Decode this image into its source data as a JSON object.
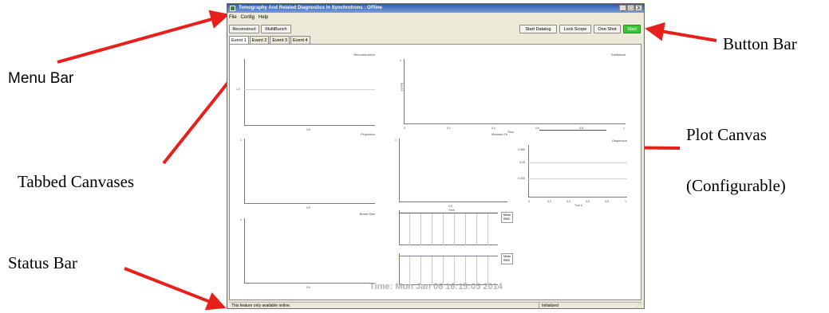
{
  "annotations": {
    "menu_bar": "Menu Bar",
    "tabbed_canvases": "Tabbed Canvases",
    "status_bar": "Status Bar",
    "button_bar": "Button Bar",
    "plot_canvas": "Plot Canvas",
    "plot_canvas_sub": "(Configurable)"
  },
  "colors": {
    "arrow": "#e8201c",
    "start_button": "#3ac43a",
    "titlebar": "#2a56b8"
  },
  "window": {
    "title": "Tomography And Related Diagnostics In Synchrotrons : Offline",
    "controls": [
      "_",
      "□",
      "X"
    ]
  },
  "menu": [
    "File",
    "Config",
    "Help"
  ],
  "toolbar": {
    "left": [
      "Reconstruct",
      "MultiBunch"
    ],
    "right": [
      "Start Datalog",
      "Lock Scope",
      "One Shot",
      "Start"
    ]
  },
  "tabs": [
    "Event 1",
    "Event 2",
    "Event 3",
    "Event 4"
  ],
  "plots": {
    "reconstruction": {
      "title": "Reconstruction",
      "ytick": "1.0",
      "xtick": "0.5"
    },
    "emittance": {
      "title": "Emittance",
      "ytick": "1",
      "ylabel": "y [mm]",
      "xticks": [
        "0",
        "0.2",
        "0.4",
        "0.6",
        "0.8",
        "1"
      ],
      "xlabel": "Time"
    },
    "projection": {
      "title": "Projection",
      "ytick": "1",
      "xtick": "0.5"
    },
    "moment_fit": {
      "title": "Moment Fit",
      "ytick": "1",
      "xtick": "0.5",
      "xlabel": "Time"
    },
    "dispersion": {
      "title": "Dispersion",
      "yticks": [
        "0.055",
        "0.05",
        "0.045"
      ],
      "xticks": [
        "0",
        "0.2",
        "0.4",
        "0.6",
        "0.8",
        "1"
      ],
      "xlabel": "Turn #"
    },
    "beam_size": {
      "title": "Beam Size",
      "ytick": "1",
      "xtick": "0.5"
    },
    "trace_blue": {
      "legend": [
        "Mean",
        "RMS"
      ],
      "color": "#4a4ad8"
    },
    "trace_pink": {
      "legend": [
        "Mean",
        "RMS"
      ],
      "color": "#e040e0"
    }
  },
  "timestamp": "Time: Mon Jan 06 16:15:05 2014",
  "status": {
    "message": "This feature only available online.",
    "state": "Initialized"
  }
}
